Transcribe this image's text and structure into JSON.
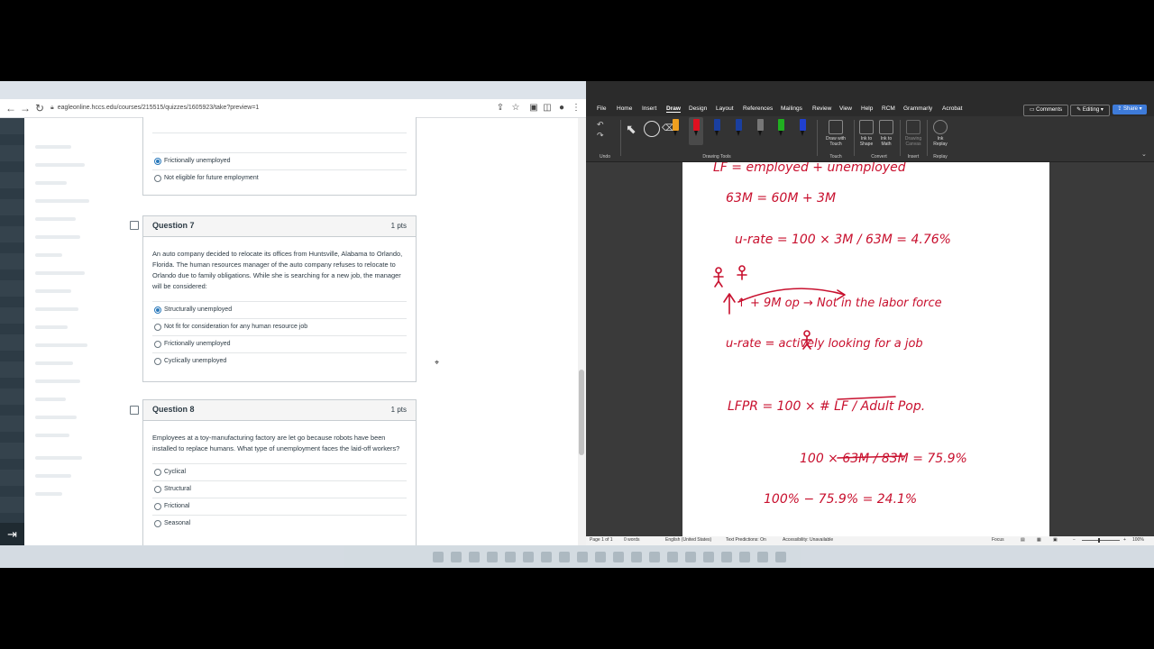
{
  "browser": {
    "url": "eagleonline.hccs.edu/courses/215515/quizzes/1605923/take?preview=1",
    "prev_question_options": [
      {
        "label": "Frictionally unemployed",
        "selected": true
      },
      {
        "label": "Not eligible for future employment",
        "selected": false
      }
    ],
    "questions": [
      {
        "title": "Question 7",
        "points": "1 pts",
        "text": "An auto company decided to relocate its offices from Huntsville, Alabama to Orlando, Florida.  The human resources manager of the auto company refuses to relocate to Orlando due to family obligations. While she is searching for a new job, the manager will be considered:",
        "options": [
          {
            "label": "Structurally unemployed",
            "selected": true
          },
          {
            "label": "Not fit for consideration for any human resource job",
            "selected": false
          },
          {
            "label": "Frictionally unemployed",
            "selected": false
          },
          {
            "label": "Cyclically unemployed",
            "selected": false
          }
        ]
      },
      {
        "title": "Question 8",
        "points": "1 pts",
        "text": "Employees at a toy-manufacturing factory are let go because robots have been installed to replace humans.  What type of unemployment faces the laid-off workers?",
        "options": [
          {
            "label": "Cyclical",
            "selected": false
          },
          {
            "label": "Structural",
            "selected": false
          },
          {
            "label": "Frictional",
            "selected": false
          },
          {
            "label": "Seasonal",
            "selected": false
          }
        ]
      }
    ]
  },
  "word": {
    "menus": [
      "File",
      "Home",
      "Insert",
      "Draw",
      "Design",
      "Layout",
      "References",
      "Mailings",
      "Review",
      "View",
      "Help",
      "RCM",
      "Grammarly",
      "Acrobat"
    ],
    "active_menu": "Draw",
    "comments_label": "Comments",
    "editing_label": "Editing",
    "share_label": "Share",
    "ribbon_groups": {
      "undo": "Undo",
      "drawing_tools": "Drawing Tools",
      "touch": "Touch",
      "convert": "Convert",
      "insert": "Insert",
      "replay": "Replay"
    },
    "ribbon_buttons": {
      "draw_with_touch": "Draw with Touch",
      "ink_to_shape": "Ink to Shape",
      "ink_to_math": "Ink to Math",
      "drawing_canvas": "Drawing Canvas",
      "ink_replay": "Ink Replay"
    },
    "pen_colors": [
      "#f0a020",
      "#e01020",
      "#1a3fa0",
      "#1a3fa0",
      "#777777",
      "#20b020",
      "#2040d0"
    ],
    "ink_lines": [
      "LF = employed + unemployed",
      "63M = 60M + 3M",
      "u-rate = 100 × 3M / 63M = 4.76%",
      "↑ + 9M op → Not in the labor force",
      "u-rate = actively looking for a job",
      "LFPR = 100 × # LF / Adult Pop.",
      "100 × 63M / 83M = 75.9%",
      "100% − 75.9% = 24.1%"
    ],
    "status": {
      "page": "Page 1 of 1",
      "words": "0 words",
      "language": "English (United States)",
      "predictions": "Text Predictions: On",
      "accessibility": "Accessibility: Unavailable",
      "focus": "Focus",
      "zoom": "100%"
    }
  }
}
